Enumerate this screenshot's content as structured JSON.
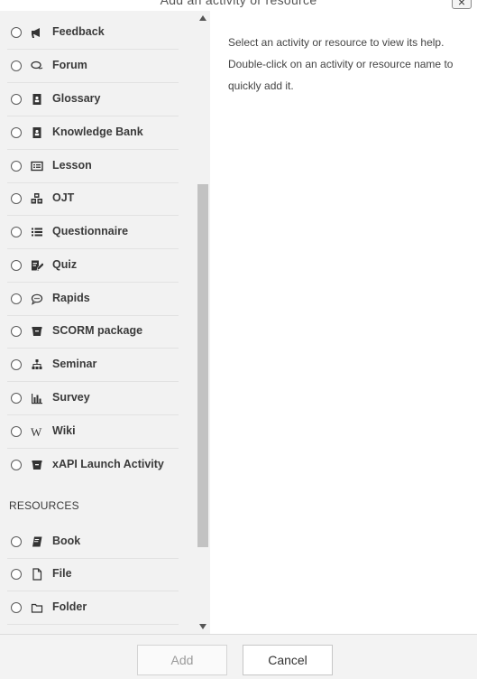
{
  "dialog": {
    "title": "Add an activity or resource",
    "close_label": "×"
  },
  "activities": [
    {
      "label": "Feedback",
      "icon": "megaphone-icon"
    },
    {
      "label": "Forum",
      "icon": "chat-bubbles-icon"
    },
    {
      "label": "Glossary",
      "icon": "book-contact-icon"
    },
    {
      "label": "Knowledge Bank",
      "icon": "book-contact-icon"
    },
    {
      "label": "Lesson",
      "icon": "lesson-icon"
    },
    {
      "label": "OJT",
      "icon": "cubes-icon"
    },
    {
      "label": "Questionnaire",
      "icon": "list-icon"
    },
    {
      "label": "Quiz",
      "icon": "quiz-edit-icon"
    },
    {
      "label": "Rapids",
      "icon": "comment-icon"
    },
    {
      "label": "SCORM package",
      "icon": "archive-box-icon"
    },
    {
      "label": "Seminar",
      "icon": "sitemap-icon"
    },
    {
      "label": "Survey",
      "icon": "bar-chart-icon"
    },
    {
      "label": "Wiki",
      "icon": "wiki-w-icon"
    },
    {
      "label": "xAPI Launch Activity",
      "icon": "archive-box-icon"
    }
  ],
  "resources_header": "RESOURCES",
  "resources": [
    {
      "label": "Book",
      "icon": "book-icon"
    },
    {
      "label": "File",
      "icon": "file-icon"
    },
    {
      "label": "Folder",
      "icon": "folder-icon"
    }
  ],
  "help_text": "Select an activity or resource to view its help. Double-click on an activity or resource name to quickly add it.",
  "buttons": {
    "add": "Add",
    "cancel": "Cancel"
  }
}
